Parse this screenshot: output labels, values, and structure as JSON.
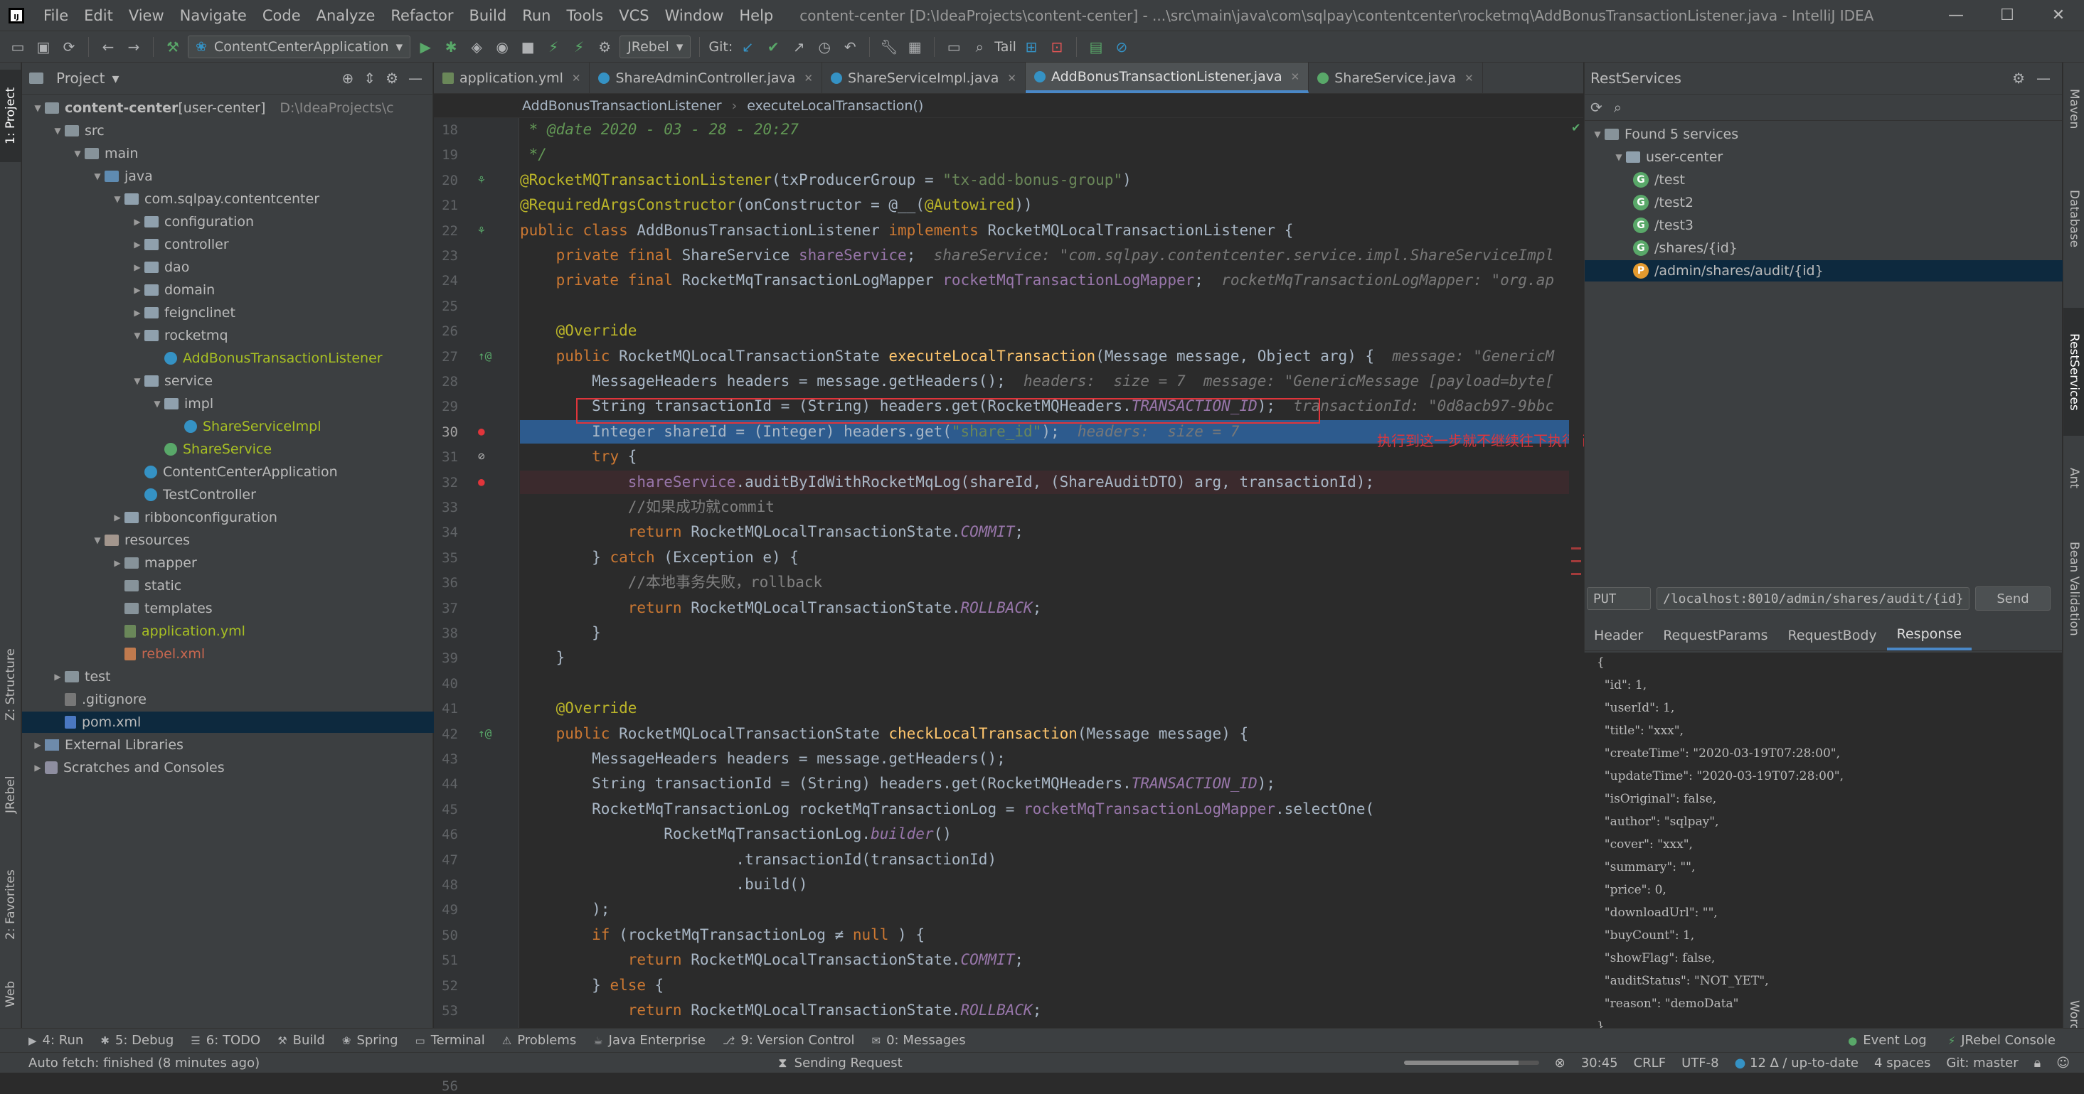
{
  "window": {
    "title": "content-center [D:\\IdeaProjects\\content-center] - ...\\src\\main\\java\\com\\sqlpay\\contentcenter\\rocketmq\\AddBonusTransactionListener.java - IntelliJ IDEA",
    "menu": [
      "File",
      "Edit",
      "View",
      "Navigate",
      "Code",
      "Analyze",
      "Refactor",
      "Build",
      "Run",
      "Tools",
      "VCS",
      "Window",
      "Help"
    ]
  },
  "toolbar": {
    "run_config": "ContentCenterApplication",
    "jrebel_combo": "JRebel",
    "git_label": "Git:",
    "tail_label": "Tail"
  },
  "left_stripe": {
    "project": "1: Project",
    "structure": "Z: Structure",
    "jrebel": "JRebel",
    "favorites": "2: Favorites",
    "web": "Web"
  },
  "project_panel": {
    "title": "Project",
    "tree": [
      {
        "label": "content-center",
        "extra": " [user-center]",
        "path": "D:\\IdeaProjects\\c",
        "arrow": "▼",
        "icon": "folder",
        "indent": 0
      },
      {
        "label": "src",
        "arrow": "▼",
        "icon": "folder",
        "indent": 1
      },
      {
        "label": "main",
        "arrow": "▼",
        "icon": "folder",
        "indent": 2
      },
      {
        "label": "java",
        "arrow": "▼",
        "icon": "folder src",
        "indent": 3
      },
      {
        "label": "com.sqlpay.contentcenter",
        "arrow": "▼",
        "icon": "pkg",
        "indent": 4
      },
      {
        "label": "configuration",
        "arrow": "▶",
        "icon": "pkg",
        "indent": 5
      },
      {
        "label": "controller",
        "arrow": "▶",
        "icon": "pkg",
        "indent": 5
      },
      {
        "label": "dao",
        "arrow": "▶",
        "icon": "pkg",
        "indent": 5
      },
      {
        "label": "domain",
        "arrow": "▶",
        "icon": "pkg",
        "indent": 5
      },
      {
        "label": "feignclinet",
        "arrow": "▶",
        "icon": "pkg",
        "indent": 5
      },
      {
        "label": "rocketmq",
        "arrow": "▼",
        "icon": "pkg",
        "indent": 5
      },
      {
        "label": "AddBonusTransactionListener",
        "arrow": "",
        "icon": "cls",
        "indent": 6,
        "color": "txt-green"
      },
      {
        "label": "service",
        "arrow": "▼",
        "icon": "pkg",
        "indent": 5
      },
      {
        "label": "impl",
        "arrow": "▼",
        "icon": "pkg",
        "indent": 6
      },
      {
        "label": "ShareServiceImpl",
        "arrow": "",
        "icon": "cls",
        "indent": 7,
        "color": "txt-green"
      },
      {
        "label": "ShareService",
        "arrow": "",
        "icon": "intf",
        "indent": 6,
        "color": "txt-green"
      },
      {
        "label": "ContentCenterApplication",
        "arrow": "",
        "icon": "cls",
        "indent": 5
      },
      {
        "label": "TestController",
        "arrow": "",
        "icon": "cls",
        "indent": 5
      },
      {
        "label": "ribbonconfiguration",
        "arrow": "▶",
        "icon": "pkg",
        "indent": 4
      },
      {
        "label": "resources",
        "arrow": "▼",
        "icon": "folder res",
        "indent": 3
      },
      {
        "label": "mapper",
        "arrow": "▶",
        "icon": "folder",
        "indent": 4
      },
      {
        "label": "static",
        "arrow": "",
        "icon": "folder",
        "indent": 4
      },
      {
        "label": "templates",
        "arrow": "",
        "icon": "folder",
        "indent": 4
      },
      {
        "label": "application.yml",
        "arrow": "",
        "icon": "yml",
        "indent": 4,
        "color": "txt-green"
      },
      {
        "label": "rebel.xml",
        "arrow": "",
        "icon": "xmlf",
        "indent": 4,
        "color": "txt-red"
      },
      {
        "label": "test",
        "arrow": "▶",
        "icon": "folder",
        "indent": 1
      },
      {
        "label": ".gitignore",
        "arrow": "",
        "icon": "git",
        "indent": 1
      },
      {
        "label": "pom.xml",
        "arrow": "",
        "icon": "mvn",
        "indent": 1,
        "selected": true
      },
      {
        "label": "External Libraries",
        "arrow": "▶",
        "icon": "lib",
        "indent": 0
      },
      {
        "label": "Scratches and Consoles",
        "arrow": "▶",
        "icon": "scr",
        "indent": 0
      }
    ]
  },
  "editor": {
    "tabs": [
      {
        "label": "application.yml",
        "icon": "y"
      },
      {
        "label": "ShareAdminController.java",
        "icon": "c"
      },
      {
        "label": "ShareServiceImpl.java",
        "icon": "c"
      },
      {
        "label": "AddBonusTransactionListener.java",
        "icon": "c",
        "active": true
      },
      {
        "label": "ShareService.java",
        "icon": "i"
      }
    ],
    "breadcrumb": [
      "AddBonusTransactionListener",
      "executeLocalTransaction()"
    ],
    "line_numbers": [
      "18",
      "19",
      "20",
      "21",
      "22",
      "23",
      "24",
      "25",
      "26",
      "27",
      "28",
      "29",
      "30",
      "31",
      "32",
      "33",
      "34",
      "35",
      "36",
      "37",
      "38",
      "39",
      "40",
      "41",
      "42",
      "43",
      "44",
      "45",
      "46",
      "47",
      "48",
      "49",
      "50",
      "51",
      "52",
      "53",
      "54",
      "55",
      "56"
    ],
    "lines": [
      [
        [
          "cmti",
          " * "
        ],
        [
          "cmti",
          "@date"
        ],
        [
          "cmti",
          " 2020 - 03 - 28 - 20:27"
        ]
      ],
      [
        [
          "cmti",
          " */"
        ]
      ],
      [
        [
          "an",
          "@RocketMQTransactionListener"
        ],
        [
          "",
          "(txProducerGroup = "
        ],
        [
          "str",
          "\"tx-add-bonus-group\""
        ],
        [
          "",
          ")"
        ]
      ],
      [
        [
          "an",
          "@RequiredArgsConstructor"
        ],
        [
          "",
          "(onConstructor = @__("
        ],
        [
          "an",
          "@Autowired"
        ],
        [
          "",
          "))"
        ]
      ],
      [
        [
          "kw",
          "public class "
        ],
        [
          "",
          "AddBonusTransactionListener "
        ],
        [
          "kw",
          "implements "
        ],
        [
          "",
          "RocketMQLocalTransactionListener {"
        ]
      ],
      [
        [
          "",
          "    "
        ],
        [
          "kw",
          "private final "
        ],
        [
          "",
          "ShareService "
        ],
        [
          "fld",
          "shareService"
        ],
        [
          "",
          ";  "
        ],
        [
          "hint",
          "shareService: \"com.sqlpay.contentcenter.service.impl.ShareServiceImpl"
        ]
      ],
      [
        [
          "",
          "    "
        ],
        [
          "kw",
          "private final "
        ],
        [
          "",
          "RocketMqTransactionLogMapper "
        ],
        [
          "fld",
          "rocketMqTransactionLogMapper"
        ],
        [
          "",
          ";  "
        ],
        [
          "hint",
          "rocketMqTransactionLogMapper: \"org.ap"
        ]
      ],
      [
        [
          "",
          ""
        ]
      ],
      [
        [
          "",
          "    "
        ],
        [
          "an",
          "@Override"
        ]
      ],
      [
        [
          "",
          "    "
        ],
        [
          "kw",
          "public "
        ],
        [
          "",
          "RocketMQLocalTransactionState "
        ],
        [
          "mth",
          "executeLocalTransaction"
        ],
        [
          "",
          "(Message message, Object arg) {  "
        ],
        [
          "hint",
          "message: \"GenericM"
        ]
      ],
      [
        [
          "",
          "        MessageHeaders headers = message.getHeaders();  "
        ],
        [
          "hint",
          "headers:  size = 7  message: \"GenericMessage [payload=byte["
        ]
      ],
      [
        [
          "",
          "        String transactionId = (String) headers.get(RocketMQHeaders."
        ],
        [
          "sfld",
          "TRANSACTION_ID"
        ],
        [
          "",
          ");  "
        ],
        [
          "hint",
          "transactionId: \"0d8acb97-9bbc"
        ]
      ],
      [
        [
          "",
          "        Integer shareId = (Integer) headers.get("
        ],
        [
          "str",
          "\"share_id\""
        ],
        [
          "",
          ");  "
        ],
        [
          "hint",
          "headers:  size = 7"
        ]
      ],
      [
        [
          "",
          "        "
        ],
        [
          "kw",
          "try "
        ],
        [
          "",
          "{"
        ]
      ],
      [
        [
          "",
          "            "
        ],
        [
          "fld",
          "shareService"
        ],
        [
          "",
          ".auditByIdWithRocketMqLog(shareId, (ShareAuditDTO) arg, transactionId);"
        ]
      ],
      [
        [
          "",
          "            "
        ],
        [
          "cmt",
          "//如果成功就commit"
        ]
      ],
      [
        [
          "",
          "            "
        ],
        [
          "kw",
          "return "
        ],
        [
          "",
          "RocketMQLocalTransactionState."
        ],
        [
          "sfld",
          "COMMIT"
        ],
        [
          "",
          ";"
        ]
      ],
      [
        [
          "",
          "        } "
        ],
        [
          "kw",
          "catch "
        ],
        [
          "",
          "(Exception e) {"
        ]
      ],
      [
        [
          "",
          "            "
        ],
        [
          "cmt",
          "//本地事务失败，rollback"
        ]
      ],
      [
        [
          "",
          "            "
        ],
        [
          "kw",
          "return "
        ],
        [
          "",
          "RocketMQLocalTransactionState."
        ],
        [
          "sfld",
          "ROLLBACK"
        ],
        [
          "",
          ";"
        ]
      ],
      [
        [
          "",
          "        }"
        ]
      ],
      [
        [
          "",
          "    }"
        ]
      ],
      [
        [
          "",
          ""
        ]
      ],
      [
        [
          "",
          "    "
        ],
        [
          "an",
          "@Override"
        ]
      ],
      [
        [
          "",
          "    "
        ],
        [
          "kw",
          "public "
        ],
        [
          "",
          "RocketMQLocalTransactionState "
        ],
        [
          "mth",
          "checkLocalTransaction"
        ],
        [
          "",
          "(Message message) {"
        ]
      ],
      [
        [
          "",
          "        MessageHeaders headers = message.getHeaders();"
        ]
      ],
      [
        [
          "",
          "        String transactionId = (String) headers.get(RocketMQHeaders."
        ],
        [
          "sfld",
          "TRANSACTION_ID"
        ],
        [
          "",
          ");"
        ]
      ],
      [
        [
          "",
          "        RocketMqTransactionLog rocketMqTransactionLog = "
        ],
        [
          "fld",
          "rocketMqTransactionLogMapper"
        ],
        [
          "",
          ".selectOne("
        ]
      ],
      [
        [
          "",
          "                RocketMqTransactionLog."
        ],
        [
          "sfld",
          "builder"
        ],
        [
          "",
          "()"
        ]
      ],
      [
        [
          "",
          "                        .transactionId(transactionId)"
        ]
      ],
      [
        [
          "",
          "                        .build()"
        ]
      ],
      [
        [
          "",
          "        );"
        ]
      ],
      [
        [
          "",
          "        "
        ],
        [
          "kw",
          "if "
        ],
        [
          "",
          "(rocketMqTransactionLog ≠ "
        ],
        [
          "kw",
          "null"
        ],
        [
          "",
          " ) {"
        ]
      ],
      [
        [
          "",
          "            "
        ],
        [
          "kw",
          "return "
        ],
        [
          "",
          "RocketMQLocalTransactionState."
        ],
        [
          "sfld",
          "COMMIT"
        ],
        [
          "",
          ";"
        ]
      ],
      [
        [
          "",
          "        } "
        ],
        [
          "kw",
          "else "
        ],
        [
          "",
          "{"
        ]
      ],
      [
        [
          "",
          "            "
        ],
        [
          "kw",
          "return "
        ],
        [
          "",
          "RocketMQLocalTransactionState."
        ],
        [
          "sfld",
          "ROLLBACK"
        ],
        [
          "",
          ";"
        ]
      ],
      [
        [
          "",
          "        }"
        ]
      ],
      [
        [
          "",
          "    }"
        ]
      ],
      [
        [
          "",
          "}"
        ]
      ]
    ],
    "error_note": "执行到这一步就不继续往下执行了"
  },
  "rest_services": {
    "title": "RestServices",
    "found_label": "Found 5 services",
    "module": "user-center",
    "endpoints": [
      {
        "method": "G",
        "path": "/test"
      },
      {
        "method": "G",
        "path": "/test2"
      },
      {
        "method": "G",
        "path": "/test3"
      },
      {
        "method": "G",
        "path": "/shares/{id}"
      },
      {
        "method": "P",
        "path": "/admin/shares/audit/{id}",
        "selected": true
      }
    ],
    "http_method": "PUT",
    "url": "/localhost:8010/admin/shares/audit/{id}",
    "send_label": "Send",
    "tabs": [
      "Header",
      "RequestParams",
      "RequestBody",
      "Response"
    ],
    "response_lines": [
      "{",
      "  \"id\": 1,",
      "  \"userId\": 1,",
      "  \"title\": \"xxx\",",
      "  \"createTime\": \"2020-03-19T07:28:00\",",
      "  \"updateTime\": \"2020-03-19T07:28:00\",",
      "  \"isOriginal\": false,",
      "  \"author\": \"sqlpay\",",
      "  \"cover\": \"xxx\",",
      "  \"summary\": \"\",",
      "  \"price\": 0,",
      "  \"downloadUrl\": \"\",",
      "  \"buyCount\": 1,",
      "  \"showFlag\": false,",
      "  \"auditStatus\": \"NOT_YET\",",
      "  \"reason\": \"demoData\"",
      "}"
    ]
  },
  "right_stripe": [
    "Maven",
    "Database",
    "RestServices",
    "Ant",
    "Bean Validation",
    "Word Book"
  ],
  "bottom_tools": {
    "left": [
      {
        "label": "4: Run",
        "icon": "▶"
      },
      {
        "label": "5: Debug",
        "icon": "✱"
      },
      {
        "label": "6: TODO",
        "icon": "☰"
      },
      {
        "label": "Build",
        "icon": "⚒"
      },
      {
        "label": "Spring",
        "icon": "❀"
      },
      {
        "label": "Terminal",
        "icon": "▭"
      },
      {
        "label": "Problems",
        "icon": "⚠"
      },
      {
        "label": "Java Enterprise",
        "icon": "☕"
      },
      {
        "label": "9: Version Control",
        "icon": "⎇"
      },
      {
        "label": "0: Messages",
        "icon": "✉"
      }
    ],
    "right": [
      {
        "label": "Event Log",
        "icon": "●"
      },
      {
        "label": "JRebel Console",
        "icon": "⚡"
      }
    ]
  },
  "status_bar": {
    "left_text": "Auto fetch: finished (8 minutes ago)",
    "center_text": "Sending Request",
    "progress": 0.85,
    "position": "30:45",
    "line_sep": "CRLF",
    "encoding": "UTF-8",
    "git_status": "12 ∆ / up-to-date",
    "indent": "4 spaces",
    "branch": "Git: master"
  },
  "colors": {
    "accent": "#4a88c7",
    "selection": "#2d5b8e",
    "error_box": "#e0353b"
  }
}
